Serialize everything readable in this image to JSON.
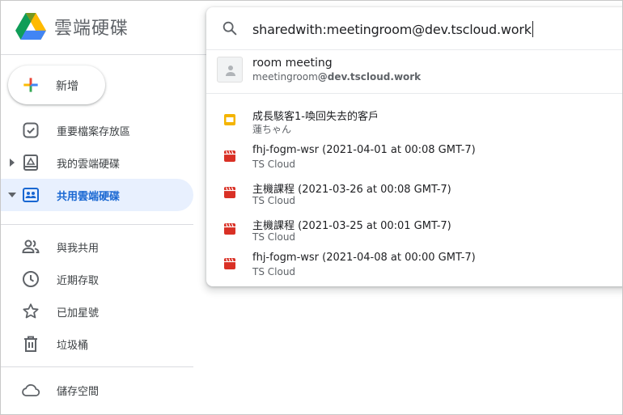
{
  "app": {
    "title": "雲端硬碟"
  },
  "new_button": {
    "label": "新增"
  },
  "sidebar": {
    "items": [
      {
        "label": "重要檔案存放區",
        "icon": "priority-check-icon"
      },
      {
        "label": "我的雲端硬碟",
        "icon": "my-drive-icon"
      },
      {
        "label": "共用雲端硬碟",
        "icon": "shared-drives-icon"
      },
      {
        "label": "與我共用",
        "icon": "people-icon"
      },
      {
        "label": "近期存取",
        "icon": "clock-icon"
      },
      {
        "label": "已加星號",
        "icon": "star-icon"
      },
      {
        "label": "垃圾桶",
        "icon": "trash-icon"
      },
      {
        "label": "儲存空間",
        "icon": "cloud-icon"
      }
    ],
    "active_item": "共用雲端硬碟"
  },
  "search": {
    "query": "sharedwith:meetingroom@dev.tscloud.work",
    "person": {
      "name": "room meeting",
      "email_user": "meetingroom",
      "email_domain": "@dev.tscloud.work"
    },
    "results": [
      {
        "title": "成長駭客1-喚回失去的客戶",
        "owner": "蓮ちゃん",
        "icon": "slides-icon"
      },
      {
        "title": "fhj-fogm-wsr (2021-04-01 at 00:08 GMT-7)",
        "owner": "TS Cloud",
        "icon": "video-icon"
      },
      {
        "title": "主機課程 (2021-03-26 at 00:08 GMT-7)",
        "owner": "TS Cloud",
        "icon": "video-icon"
      },
      {
        "title": "主機課程 (2021-03-25 at 00:01 GMT-7)",
        "owner": "TS Cloud",
        "icon": "video-icon"
      },
      {
        "title": "fhj-fogm-wsr (2021-04-08 at 00:00 GMT-7)",
        "owner": "TS Cloud",
        "icon": "video-icon"
      }
    ]
  },
  "colors": {
    "active_bg": "#e8f0fe",
    "active_text": "#1967d2",
    "slides": "#f4b400",
    "video": "#d93025"
  }
}
